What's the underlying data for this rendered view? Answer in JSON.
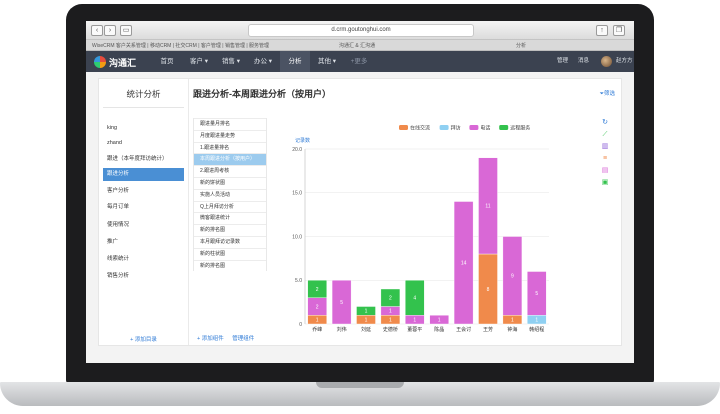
{
  "browser": {
    "url": "d.crm.goutonghui.com",
    "tabs": [
      "WiseCRM 客户关系管理 | 移动CRM | 社交CRM | 客户管理 | 销售管理 | 服务管理",
      "沟通汇 & 汇沟通",
      "分析"
    ]
  },
  "nav": {
    "logo": "沟通汇",
    "items": [
      "首页",
      "客户",
      "销售",
      "办公",
      "分析",
      "其他",
      "+更多"
    ],
    "active_index": 4,
    "right": [
      "管理",
      "消息",
      "赵方方"
    ]
  },
  "left_panel": {
    "title": "统计分析",
    "items": [
      "king",
      "zhand",
      "跟进（本年度拜访统计）",
      "跟进分析",
      "客户分析",
      "每月订单",
      "使用情况",
      "推广",
      "线索统计",
      "销售分析"
    ],
    "active_index": 3,
    "add_label": "+ 添加目录"
  },
  "page_title": "跟进分析-本周跟进分析（按用户）",
  "filter_label": "筛选",
  "mid_list": {
    "items": [
      "跟进量月排名",
      "月度跟进量走势",
      "1.跟进量排名",
      "本周跟进分析（按用户）",
      "2.跟进周考核",
      "新的饼状图",
      "实施人员活动",
      "Q上月拜访分析",
      "微客跟进统计",
      "新的排名图",
      "本月跟拜访记录数",
      "新的柱状图",
      "新的排名图"
    ],
    "active_index": 3,
    "add_label": "+ 添加组件",
    "manage_label": "管理组件"
  },
  "chart_data": {
    "type": "bar",
    "stacked": true,
    "ylabel": "记录数",
    "ylim": [
      0,
      20
    ],
    "yticks": [
      "0",
      "5.0",
      "10.0",
      "15.0",
      "20.0"
    ],
    "categories": [
      "乔峰",
      "刘伟",
      "刘延",
      "史德桥",
      "董蓉平",
      "陈晶",
      "王会讨",
      "王芳",
      "钟海",
      "韩绍程"
    ],
    "series": [
      {
        "name": "在线交流",
        "color": "#f08a4b",
        "values": [
          1,
          0,
          1,
          1,
          0,
          0,
          0,
          8,
          1,
          0
        ]
      },
      {
        "name": "拜访",
        "color": "#8fd0f2",
        "values": [
          0,
          0,
          0,
          0,
          0,
          0,
          0,
          0,
          0,
          1
        ]
      },
      {
        "name": "电话",
        "color": "#d968d6",
        "values": [
          2,
          5,
          0,
          1,
          1,
          1,
          14,
          11,
          9,
          5
        ]
      },
      {
        "name": "远程服务",
        "color": "#33c24d",
        "values": [
          2,
          0,
          1,
          2,
          4,
          0,
          0,
          0,
          0,
          0
        ]
      }
    ],
    "bar_labels": [
      [
        "1",
        "",
        "2",
        "2"
      ],
      [
        "",
        "",
        "5",
        ""
      ],
      [
        "1",
        "",
        "",
        "1"
      ],
      [
        "1",
        "",
        "1",
        "2"
      ],
      [
        "",
        "",
        "1",
        "4"
      ],
      [
        "",
        "",
        "1",
        ""
      ],
      [
        "",
        "",
        "14",
        ""
      ],
      [
        "8",
        "",
        "11",
        ""
      ],
      [
        "1",
        "",
        "9",
        ""
      ],
      [
        "",
        "1",
        "5",
        ""
      ]
    ]
  },
  "right_icons": [
    "refresh-icon",
    "line-chart-icon",
    "bar-chart-icon",
    "list-icon",
    "table-icon",
    "export-icon"
  ]
}
